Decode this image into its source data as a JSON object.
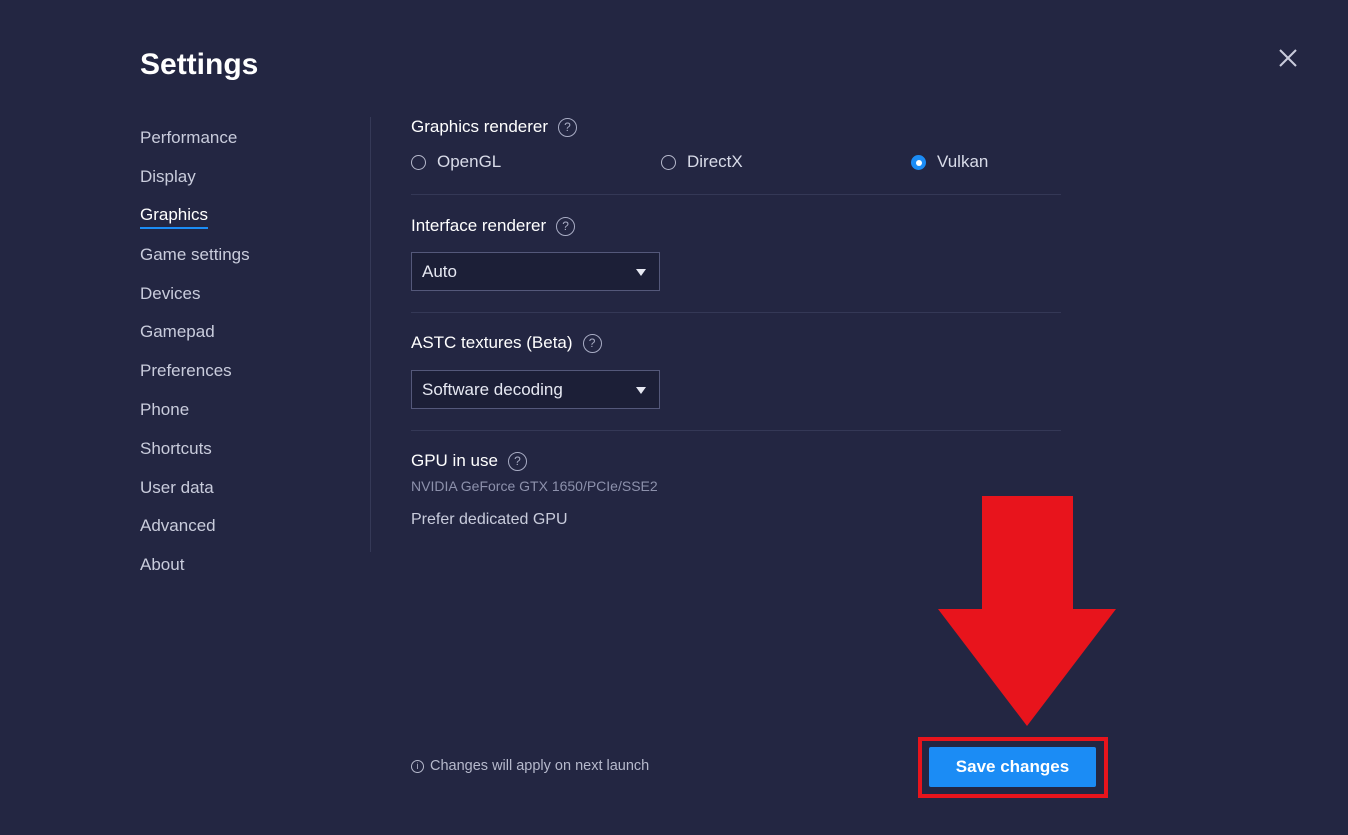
{
  "window": {
    "title": "Settings"
  },
  "sidebar": {
    "items": [
      {
        "label": "Performance"
      },
      {
        "label": "Display"
      },
      {
        "label": "Graphics",
        "active": true
      },
      {
        "label": "Game settings"
      },
      {
        "label": "Devices"
      },
      {
        "label": "Gamepad"
      },
      {
        "label": "Preferences"
      },
      {
        "label": "Phone"
      },
      {
        "label": "Shortcuts"
      },
      {
        "label": "User data"
      },
      {
        "label": "Advanced"
      },
      {
        "label": "About"
      }
    ]
  },
  "graphics": {
    "renderer": {
      "label": "Graphics renderer",
      "options": [
        "OpenGL",
        "DirectX",
        "Vulkan"
      ],
      "selected": "Vulkan"
    },
    "interface_renderer": {
      "label": "Interface renderer",
      "value": "Auto"
    },
    "astc": {
      "label": "ASTC textures (Beta)",
      "value": "Software decoding"
    },
    "gpu": {
      "label": "GPU in use",
      "name": "NVIDIA GeForce GTX 1650/PCIe/SSE2",
      "prefer_label": "Prefer dedicated GPU"
    }
  },
  "footer": {
    "note": "Changes will apply on next launch",
    "save_label": "Save changes"
  },
  "icons": {
    "help": "question-circle-icon",
    "close": "close-icon",
    "info": "info-icon",
    "dropdown": "caret-down-icon"
  },
  "colors": {
    "background": "#232642",
    "accent": "#1b8cf5",
    "highlight": "#e8141c"
  }
}
